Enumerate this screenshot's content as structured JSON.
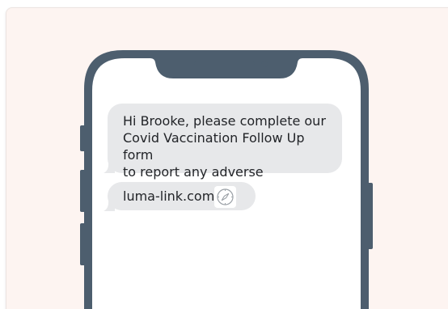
{
  "message": {
    "recipient_text": "Hi Brooke, please complete our\nCovid Vaccination Follow Up form\nto report any adverse reactions.",
    "link_text": "luma-link.com"
  },
  "colors": {
    "background": "#fdf4f1",
    "phone_frame": "#4d5e6e",
    "screen": "#ffffff",
    "bubble": "#e7e8ea",
    "text": "#222428"
  },
  "icons": {
    "link_icon": "compass-icon",
    "notch_sensor": "camera-icon"
  }
}
